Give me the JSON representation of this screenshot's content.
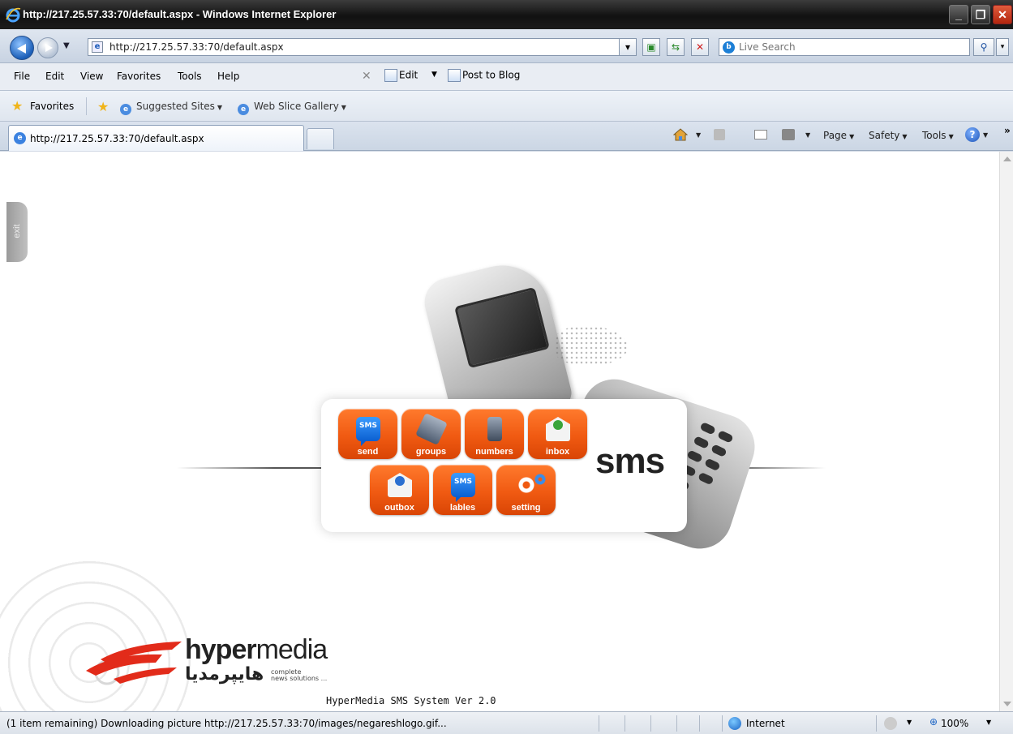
{
  "window": {
    "title": "http://217.25.57.33:70/default.aspx - Windows Internet Explorer",
    "min_label": "_",
    "max_label": "❐",
    "close_label": "✕"
  },
  "address_bar": {
    "url": "http://217.25.57.33:70/default.aspx",
    "search_placeholder": "Live Search"
  },
  "menu": {
    "file": "File",
    "edit": "Edit",
    "view": "View",
    "favorites": "Favorites",
    "tools": "Tools",
    "help": "Help",
    "edit_button": "Edit",
    "post_to_blog": "Post to Blog"
  },
  "favorites_bar": {
    "label": "Favorites",
    "suggested_sites": "Suggested Sites",
    "web_slice_gallery": "Web Slice Gallery"
  },
  "tabs": [
    {
      "label": "http://217.25.57.33:70/default.aspx",
      "active": true
    }
  ],
  "command_bar": {
    "page": "Page",
    "safety": "Safety",
    "tools": "Tools"
  },
  "page": {
    "exit_label": "exit",
    "sms_word": "sms",
    "buttons": [
      {
        "label": "send",
        "icon": "sms-bubble-icon"
      },
      {
        "label": "groups",
        "icon": "phones-group-icon"
      },
      {
        "label": "numbers",
        "icon": "mobile-phone-icon"
      },
      {
        "label": "inbox",
        "icon": "envelope-down-arrow-icon"
      },
      {
        "label": "outbox",
        "icon": "envelope-up-arrow-icon"
      },
      {
        "label": "lables",
        "icon": "sms-bubbles-icon"
      },
      {
        "label": "setting",
        "icon": "gears-icon"
      }
    ],
    "logo": {
      "name_bold": "hyper",
      "name_light": "media",
      "arabic": "هایپرمدیا",
      "tagline_line1": "complete",
      "tagline_line2": "news solutions ..."
    },
    "version": "HyperMedia SMS System Ver 2.0"
  },
  "status_bar": {
    "text": "(1 item remaining) Downloading picture http://217.25.57.33:70/images/negareshlogo.gif...",
    "zone": "Internet",
    "zoom": "100%"
  },
  "colors": {
    "button_orange": "#f05a12",
    "sms_blue": "#0b5fd0",
    "titlebar": "#1c1c1c"
  }
}
